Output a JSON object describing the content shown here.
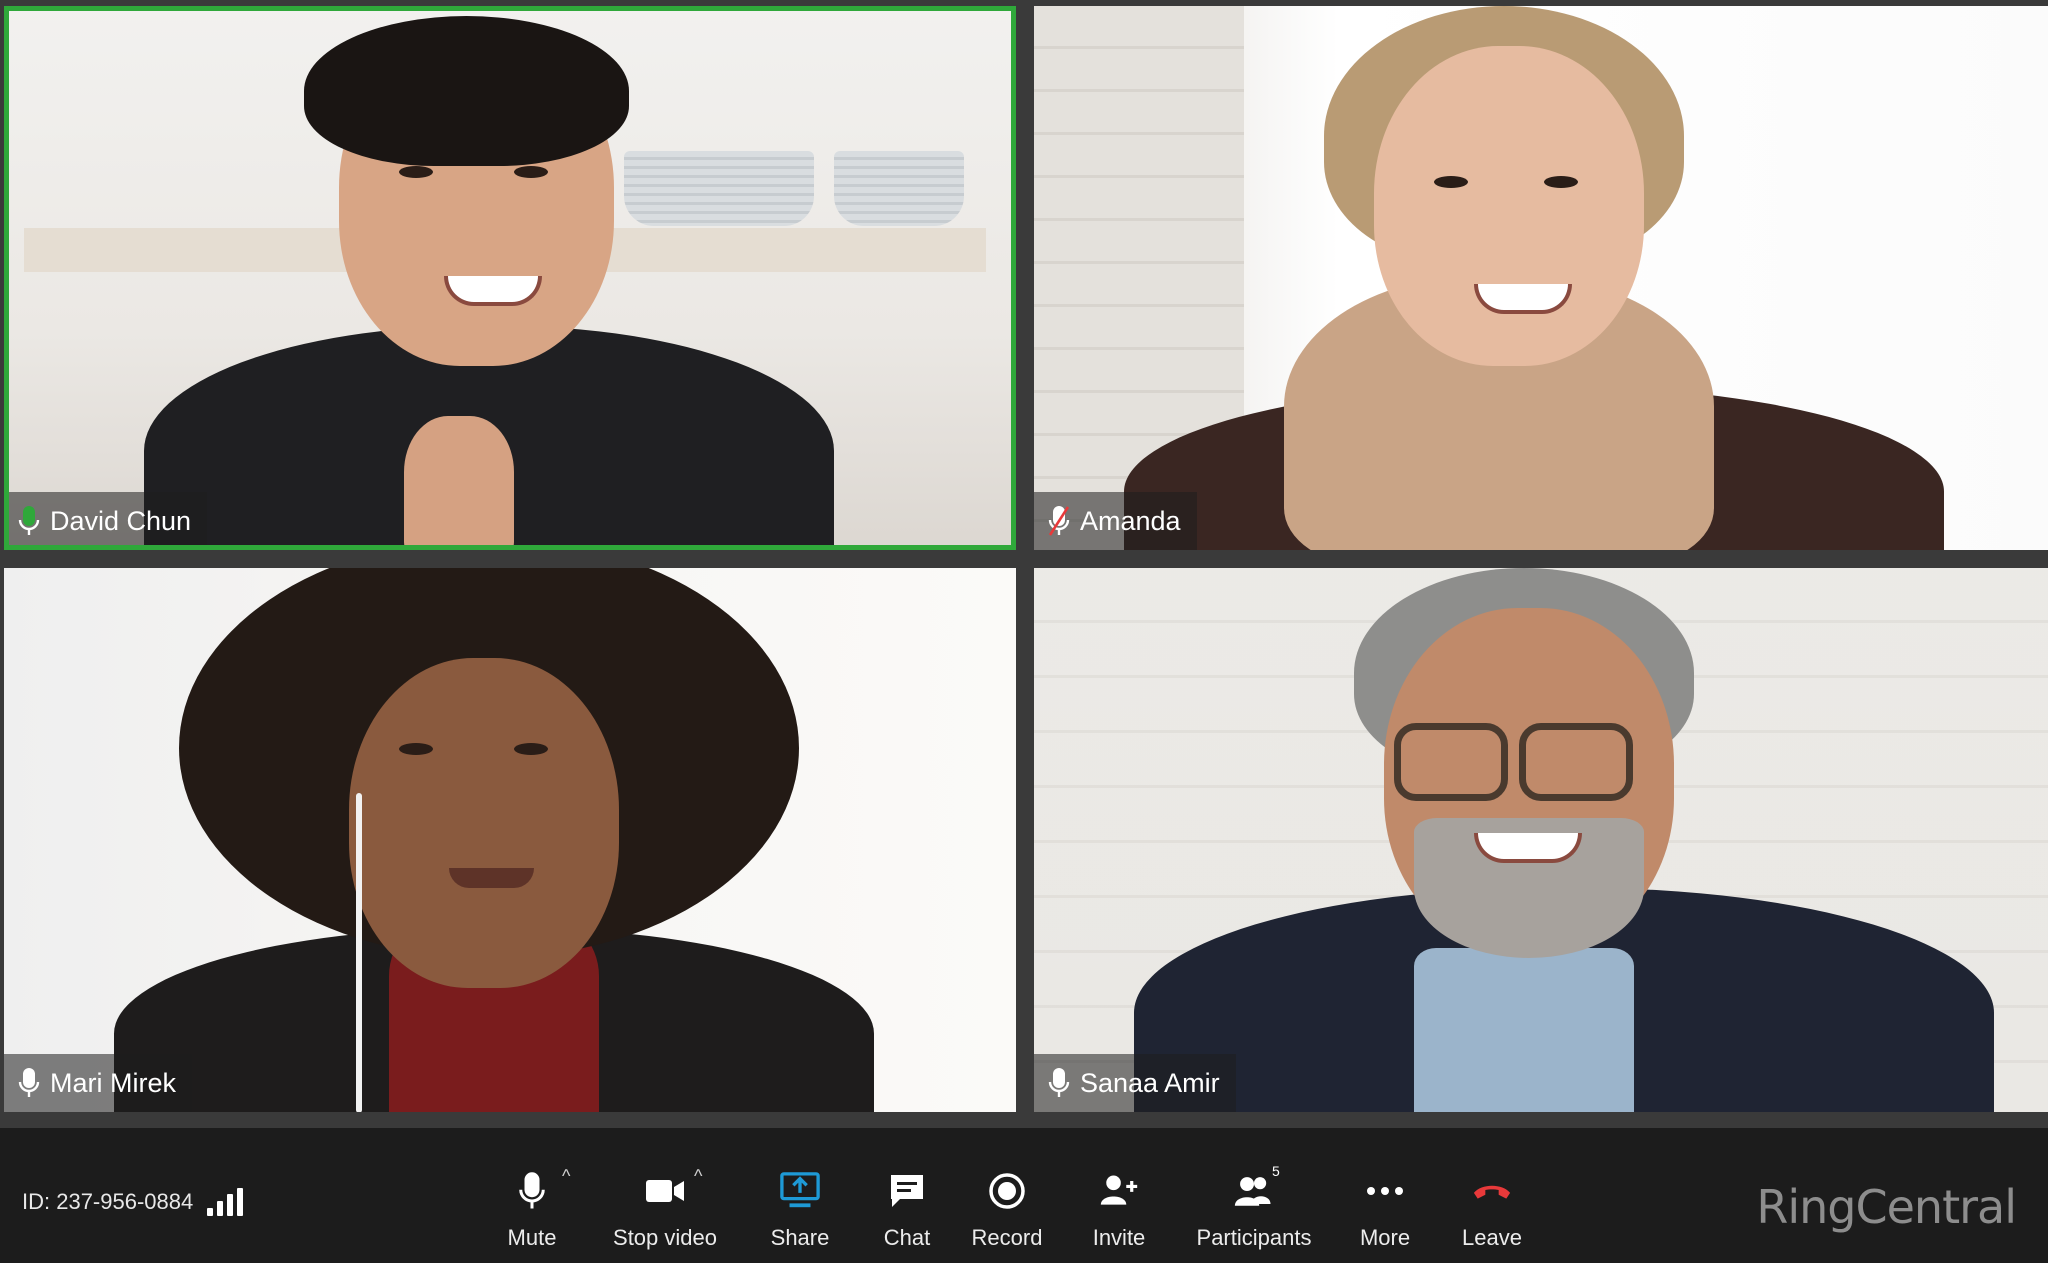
{
  "participants": [
    {
      "name": "David Chun",
      "mic": "on-active",
      "active_speaker": true
    },
    {
      "name": "Amanda",
      "mic": "muted",
      "active_speaker": false
    },
    {
      "name": "Mari Mirek",
      "mic": "on",
      "active_speaker": false
    },
    {
      "name": "Sanaa Amir",
      "mic": "on",
      "active_speaker": false
    }
  ],
  "meeting": {
    "id_text": "ID: 237-956-0884",
    "signal_icon": "signal-bars-icon"
  },
  "toolbar": {
    "mute": "Mute",
    "stop_video": "Stop video",
    "share": "Share",
    "chat": "Chat",
    "record": "Record",
    "invite": "Invite",
    "participants": "Participants",
    "participants_count": "5",
    "more": "More",
    "leave": "Leave",
    "caret": "^"
  },
  "brand": "RingCentral",
  "colors": {
    "active_speaker": "#2fa83a",
    "share_accent": "#1e9ad6",
    "leave": "#e8393a",
    "toolbar_bg": "#1c1c1c"
  }
}
